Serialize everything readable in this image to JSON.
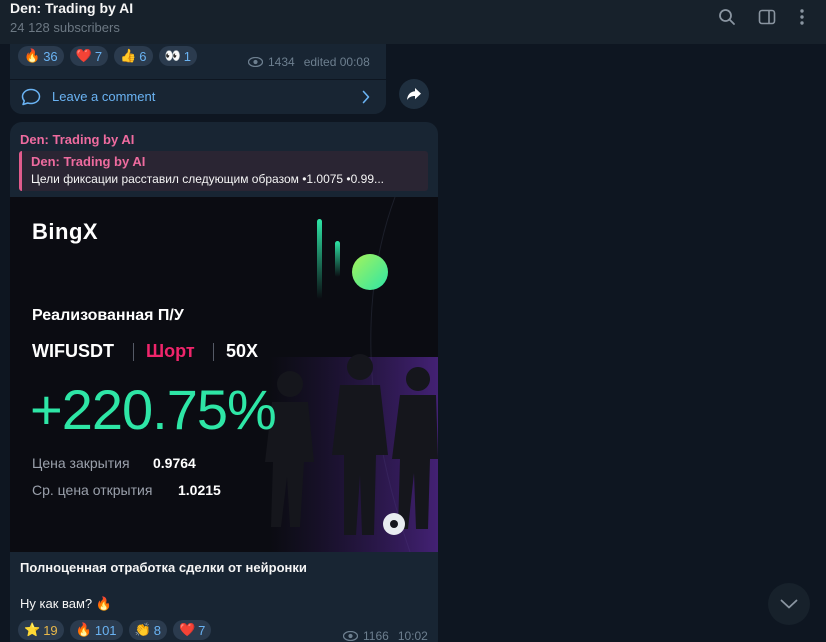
{
  "header": {
    "title": "Den: Trading by AI",
    "subtitle": "24 128 subscribers",
    "icons": [
      "search-icon",
      "sidebar-icon",
      "more-icon"
    ]
  },
  "msg1": {
    "reactions": [
      {
        "emoji": "🔥",
        "count": "36"
      },
      {
        "emoji": "❤️",
        "count": "7"
      },
      {
        "emoji": "👍",
        "count": "6"
      },
      {
        "emoji": "👀",
        "count": "1"
      }
    ],
    "views": "1434",
    "edited": "edited 00:08",
    "comment_label": "Leave a comment"
  },
  "msg2": {
    "author": "Den: Trading by AI",
    "reply": {
      "name": "Den: Trading by AI",
      "text": "Цели фиксации расставил следующим образом  •1.0075 •0.99..."
    },
    "banner": {
      "brand": "BingX",
      "realized": "Реализованная П/У",
      "pair": "WIFUSDT",
      "direction": "Шорт",
      "leverage": "50X",
      "pnl": "+220.75%",
      "close_label": "Цена закрытия",
      "close_value": "0.9764",
      "open_label": "Ср. цена открытия",
      "open_value": "1.0215"
    },
    "caption": "Полноценная отработка сделки от нейронки",
    "text": "Ну как вам? 🔥",
    "reactions": [
      {
        "emoji": "⭐",
        "count": "19"
      },
      {
        "emoji": "🔥",
        "count": "101"
      },
      {
        "emoji": "👏",
        "count": "8"
      },
      {
        "emoji": "❤️",
        "count": "7"
      }
    ],
    "views": "1166",
    "time": "10:02"
  },
  "colors": {
    "background": "#0e1621",
    "bubble": "#182533",
    "accent": "#6ab3f3",
    "author": "#ee6b9f",
    "pnl": "#2ee6a6",
    "short": "#f0256b"
  }
}
